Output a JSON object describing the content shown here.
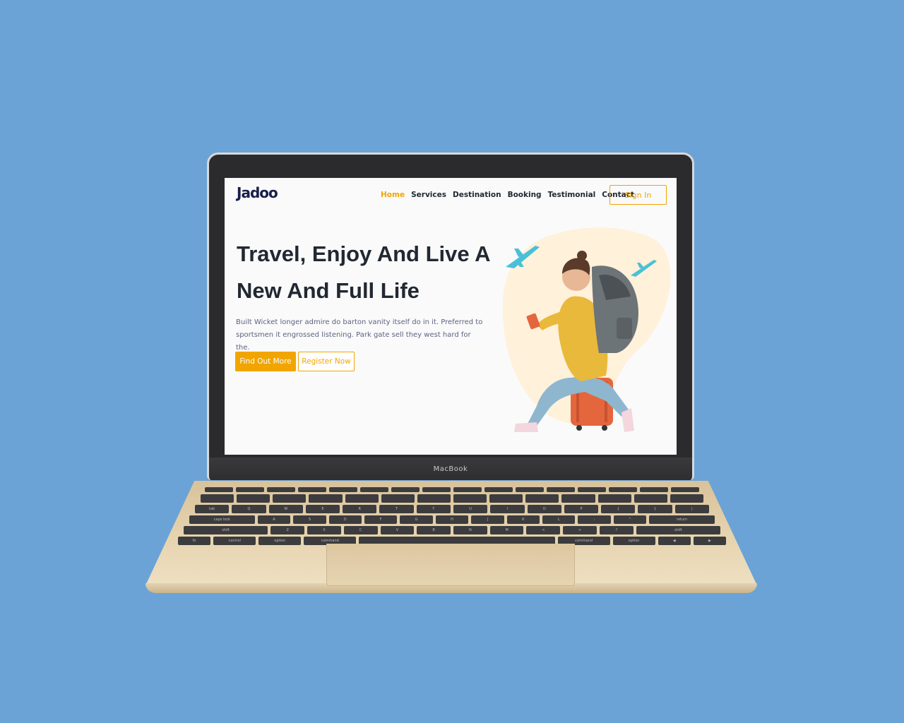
{
  "device": {
    "label": "MacBook"
  },
  "site": {
    "logo": {
      "text": "Jadoo",
      "accent_color": "#f1a501"
    },
    "nav": {
      "items": [
        {
          "label": "Home",
          "active": true
        },
        {
          "label": "Services",
          "active": false
        },
        {
          "label": "Destination",
          "active": false
        },
        {
          "label": "Booking",
          "active": false
        },
        {
          "label": "Testimonial",
          "active": false
        },
        {
          "label": "Contact",
          "active": false
        }
      ],
      "signin_label": "Sign In"
    },
    "hero": {
      "title": "Travel, Enjoy And Live A New And Full Life",
      "description": "Built Wicket longer admire do barton vanity itself do in it. Preferred to sportsmen it engrossed listening. Park gate sell they west hard for the.",
      "primary_button": "Find Out More",
      "secondary_button": "Register Now"
    }
  },
  "keyboard": {
    "row2": [
      "tab",
      "Q",
      "W",
      "E",
      "R",
      "T",
      "Y",
      "U",
      "I",
      "O",
      "P",
      "{",
      "}",
      "|"
    ],
    "row3": [
      "caps lock",
      "A",
      "S",
      "D",
      "F",
      "G",
      "H",
      "J",
      "K",
      "L",
      ":",
      "\"",
      "return"
    ],
    "row4": [
      "shift",
      "Z",
      "X",
      "C",
      "V",
      "B",
      "N",
      "M",
      "<",
      ">",
      "?",
      "shift"
    ],
    "row5": [
      "fn",
      "control",
      "option",
      "command",
      "",
      "command",
      "option",
      "◀",
      "▶"
    ]
  },
  "colors": {
    "background": "#6ba3d6",
    "accent": "#f1a501",
    "heading": "#212832",
    "body_text": "#5e6282"
  }
}
